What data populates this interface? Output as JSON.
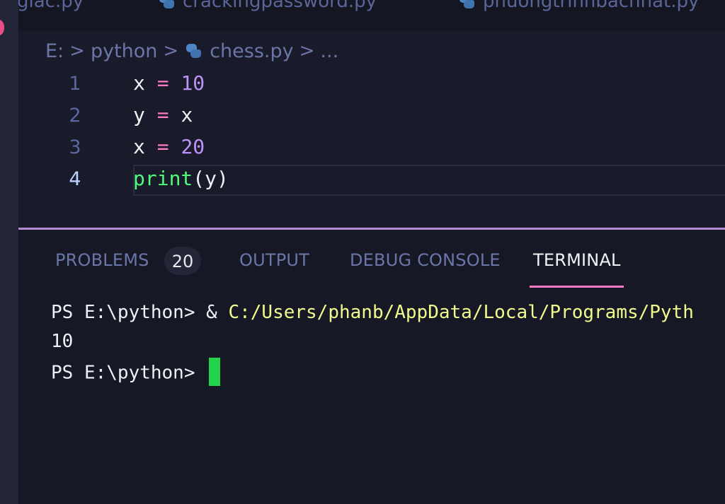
{
  "tabs": [
    {
      "label": "giac.py"
    },
    {
      "label": "crackingpassword.py"
    },
    {
      "label": "phuongtrinhbacnhat.py"
    }
  ],
  "breadcrumb": {
    "drive": "E:",
    "folder": "python",
    "file": "chess.py",
    "more": "...",
    "separator": ">"
  },
  "editor": {
    "lines": [
      {
        "number": "1",
        "tokens": {
          "a": "x",
          "op": "=",
          "b": "10"
        }
      },
      {
        "number": "2",
        "tokens": {
          "a": "y",
          "op": "=",
          "b": "x"
        }
      },
      {
        "number": "3",
        "tokens": {
          "a": "x",
          "op": "=",
          "b": "20"
        }
      },
      {
        "number": "4",
        "tokens": {
          "fn": "print",
          "open": "(",
          "arg": "y",
          "close": ")"
        }
      }
    ]
  },
  "panel": {
    "tabs": {
      "problems": "PROBLEMS",
      "problems_count": "20",
      "output": "OUTPUT",
      "debug_console": "DEBUG CONSOLE",
      "terminal": "TERMINAL"
    },
    "terminal": {
      "line1_prompt": "PS E:\\python> & ",
      "line1_cmd": "C:/Users/phanb/AppData/Local/Programs/Pyth",
      "line2": "10",
      "line3_prompt": "PS E:\\python> "
    }
  },
  "colors": {
    "accent_pink": "#ff79c6",
    "number_purple": "#bd93f9",
    "function_green": "#50fa7b",
    "terminal_path_yellow": "#f1fa8c",
    "cursor_green": "#22d34a"
  }
}
